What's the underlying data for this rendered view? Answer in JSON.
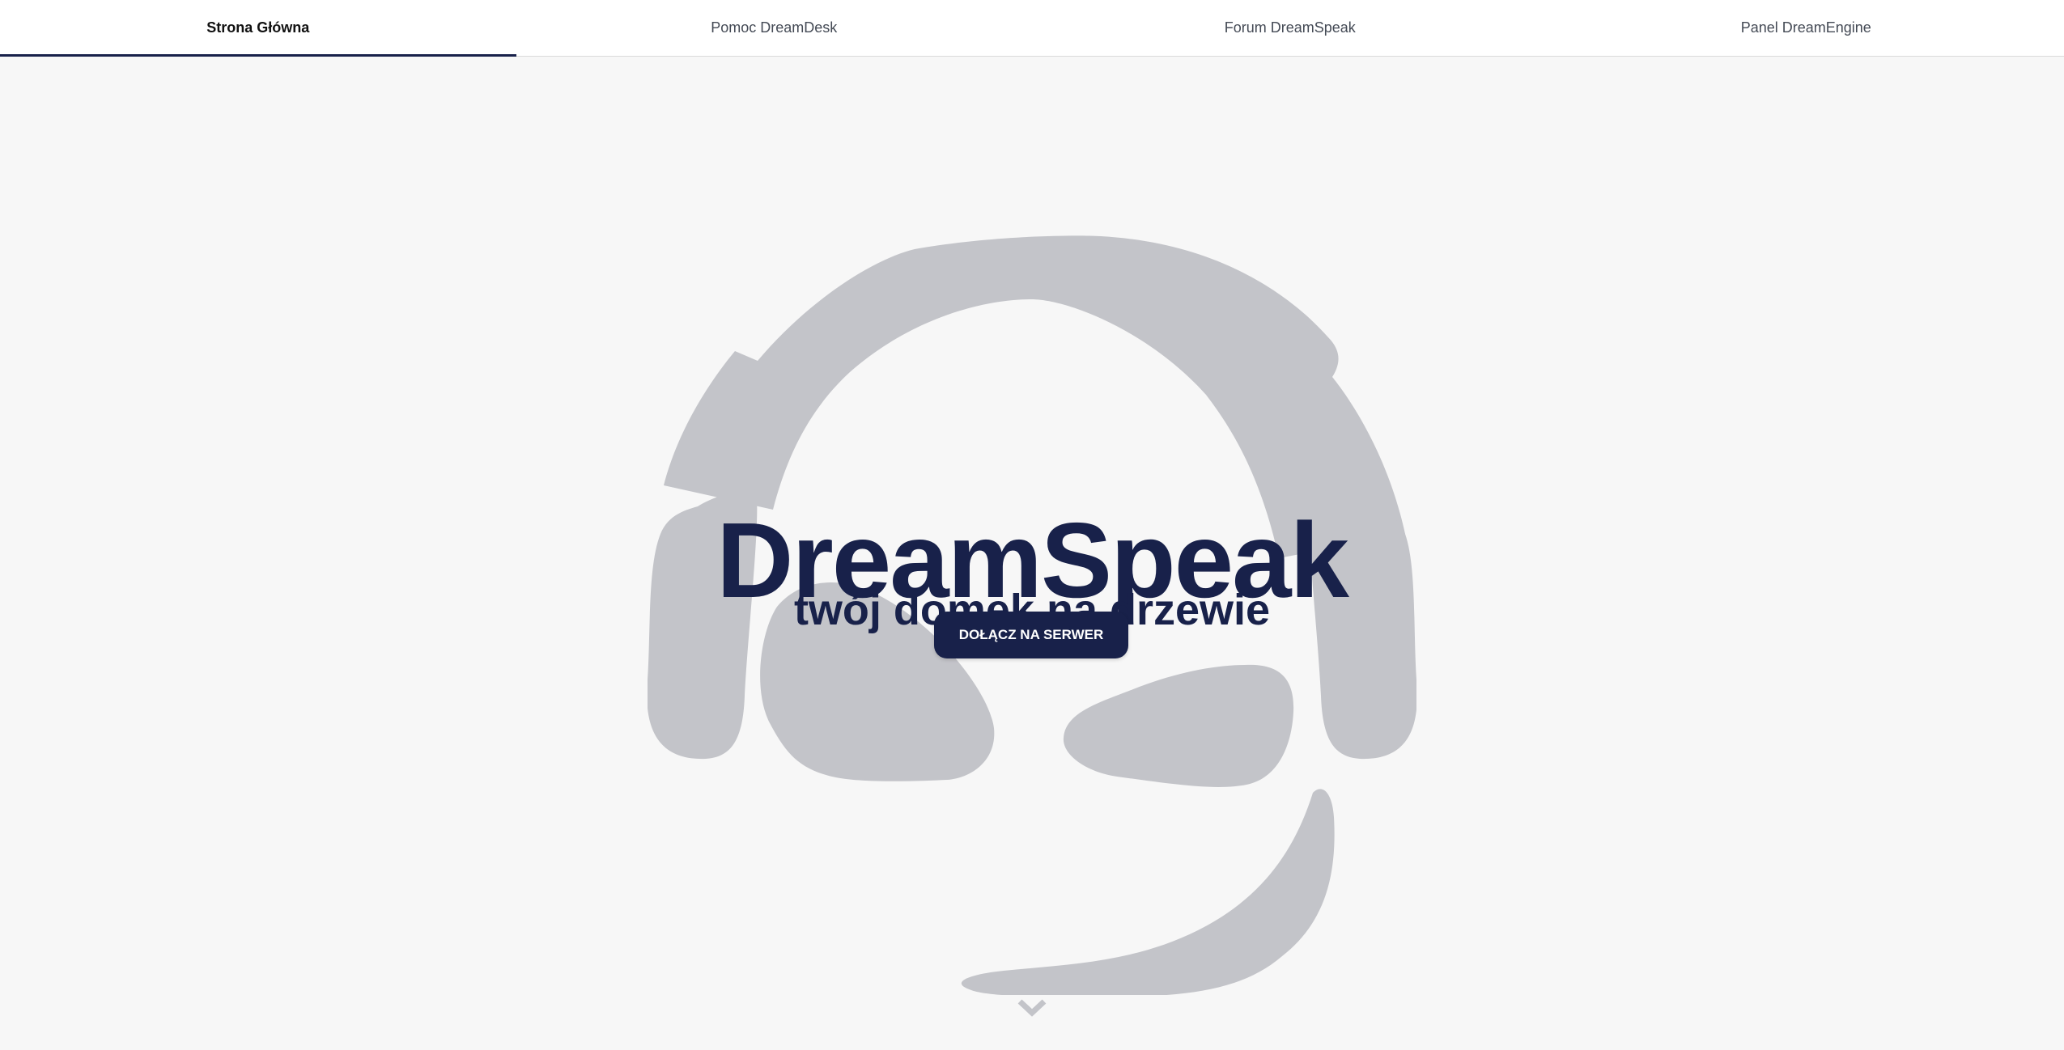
{
  "nav": {
    "tabs": [
      {
        "label": "Strona Główna",
        "active": true
      },
      {
        "label": "Pomoc DreamDesk",
        "active": false
      },
      {
        "label": "Forum DreamSpeak",
        "active": false
      },
      {
        "label": "Panel DreamEngine",
        "active": false
      }
    ]
  },
  "hero": {
    "title": "DreamSpeak",
    "subtitle": "twój domek na drzewie",
    "cta_label": "DOŁĄCZ NA SERWER",
    "background_icon": "headset-icon",
    "scroll_icon": "chevron-down-icon"
  },
  "colors": {
    "accent": "#18214a",
    "background": "#f7f7f7",
    "icon_gray": "#c3c4c9"
  }
}
